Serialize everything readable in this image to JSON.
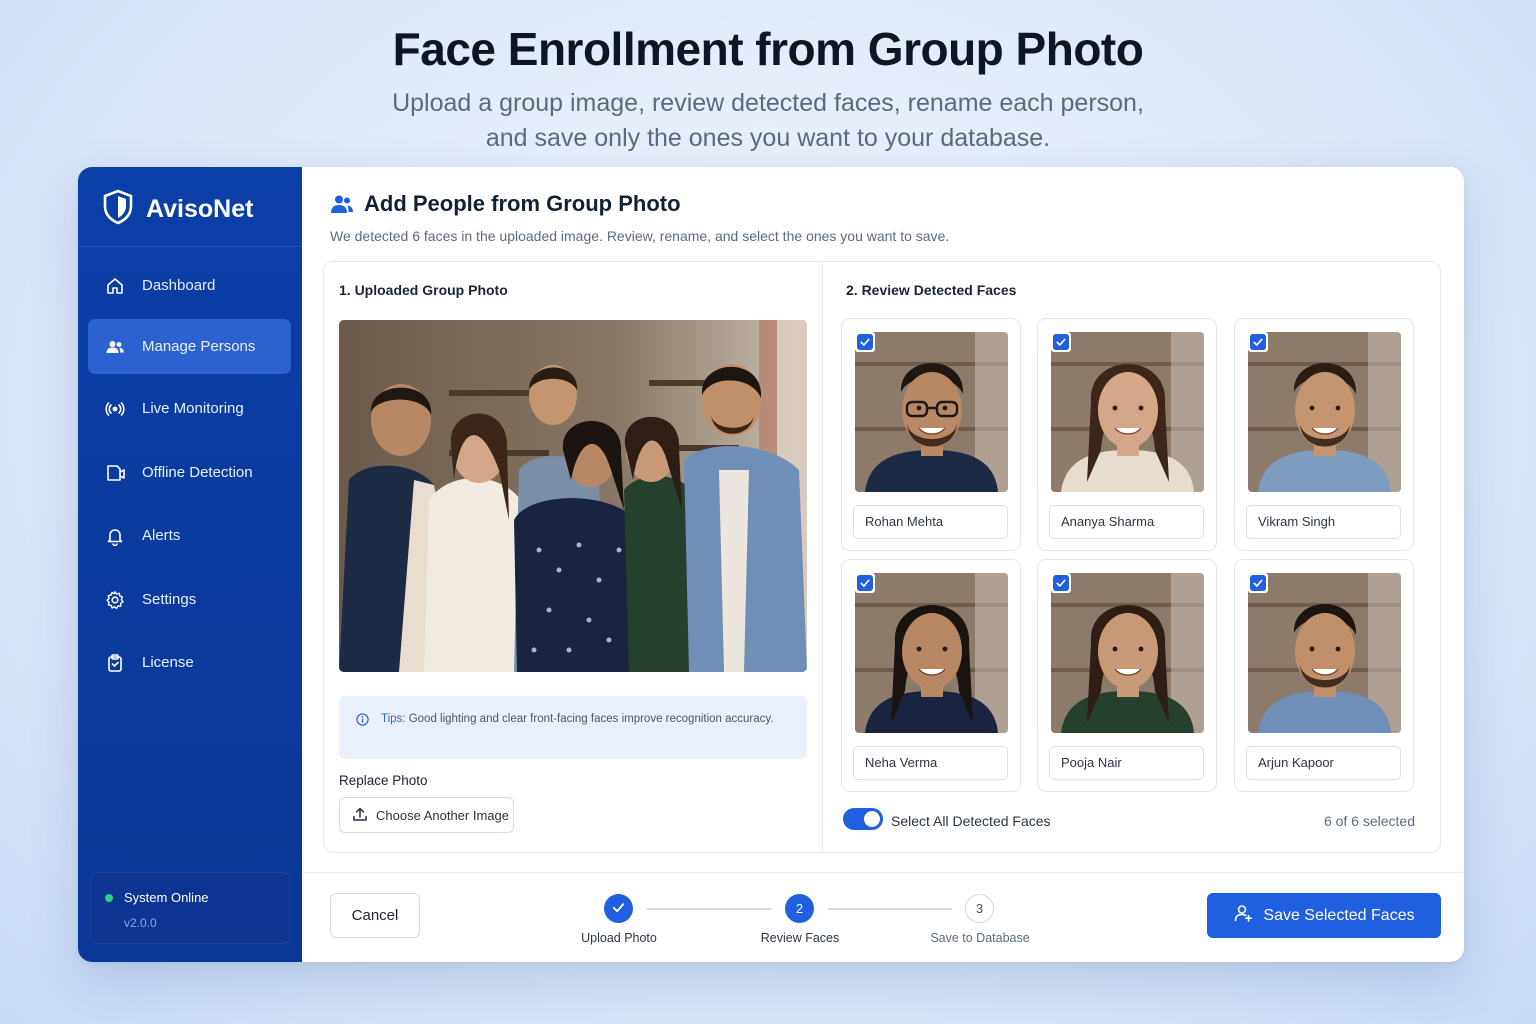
{
  "hero": {
    "title": "Face Enrollment from Group Photo",
    "subtitle_line1": "Upload a group image, review detected faces, rename each person,",
    "subtitle_line2": "and save only the ones you want to your database."
  },
  "sidebar": {
    "brand": "AvisoNet",
    "brand_icon": "shield-icon",
    "items": [
      {
        "label": "Dashboard",
        "icon": "home-icon",
        "active": false
      },
      {
        "label": "Manage Persons",
        "icon": "users-icon",
        "active": true
      },
      {
        "label": "Live Monitoring",
        "icon": "live-broadcast-icon",
        "active": false
      },
      {
        "label": "Offline Detection",
        "icon": "video-file-icon",
        "active": false
      },
      {
        "label": "Alerts",
        "icon": "bell-icon",
        "active": false
      },
      {
        "label": "Settings",
        "icon": "gear-icon",
        "active": false
      },
      {
        "label": "License",
        "icon": "clipboard-icon",
        "active": false
      }
    ],
    "status": {
      "text": "System Online",
      "version": "v2.0.0",
      "color": "#2ed27a"
    }
  },
  "main": {
    "title": "Add People from Group Photo",
    "subtitle": "We detected 6 faces in the uploaded image. Review, rename, and select the ones you want to save.",
    "upload_section": {
      "title": "1. Uploaded Group Photo",
      "tip_label": "Tips:",
      "tip_text": "Good lighting and clear front-facing faces improve recognition accuracy.",
      "replace_label": "Replace Photo",
      "choose_button": "Choose Another Image"
    },
    "review_section": {
      "title": "2. Review Detected Faces",
      "faces": [
        {
          "name": "Rohan Mehta",
          "checked": true,
          "skin": "#b88763",
          "hair": "#1e1712",
          "shirt": "#1d2a44",
          "glasses": true,
          "beard": true
        },
        {
          "name": "Ananya Sharma",
          "checked": true,
          "skin": "#d3a787",
          "hair": "#3b2619",
          "shirt": "#e6ddd0",
          "glasses": false,
          "beard": false
        },
        {
          "name": "Vikram Singh",
          "checked": true,
          "skin": "#c4956f",
          "hair": "#2a1d14",
          "shirt": "#7d9cc0",
          "glasses": false,
          "beard": true
        },
        {
          "name": "Neha Verma",
          "checked": true,
          "skin": "#b98664",
          "hair": "#1b130f",
          "shirt": "#1a2440",
          "glasses": false,
          "beard": false
        },
        {
          "name": "Pooja Nair",
          "checked": true,
          "skin": "#c99a78",
          "hair": "#2e1e15",
          "shirt": "#26402e",
          "glasses": false,
          "beard": false
        },
        {
          "name": "Arjun Kapoor",
          "checked": true,
          "skin": "#c18f6a",
          "hair": "#1d1511",
          "shirt": "#6f8fb8",
          "glasses": false,
          "beard": true
        }
      ],
      "select_all_label": "Select All Detected Faces",
      "select_all_on": true,
      "selected_count": "6 of 6 selected"
    }
  },
  "footer": {
    "cancel": "Cancel",
    "steps": [
      {
        "number": "1",
        "label": "Upload Photo",
        "state": "done"
      },
      {
        "number": "2",
        "label": "Review Faces",
        "state": "current"
      },
      {
        "number": "3",
        "label": "Save to Database",
        "state": "todo"
      }
    ],
    "save_button": "Save Selected Faces"
  },
  "colors": {
    "accent": "#1f5fe0",
    "sidebar": "#0b3fa8",
    "sidebar_active": "#2c62d0"
  }
}
